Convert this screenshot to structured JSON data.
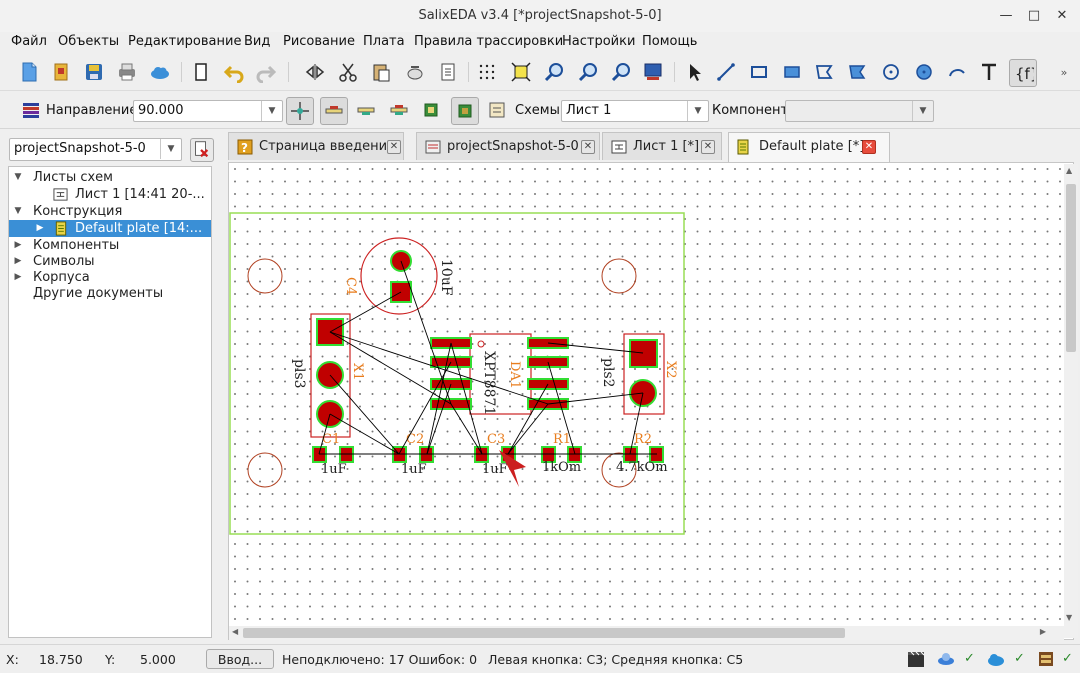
{
  "window": {
    "title": "SalixEDA v3.4 [*projectSnapshot-5-0]"
  },
  "menu": [
    "Файл",
    "Объекты",
    "Редактирование",
    "Вид",
    "Рисование",
    "Плата",
    "Правила трассировки",
    "Настройки",
    "Помощь"
  ],
  "toolbar2": {
    "direction_label": "Направление:",
    "direction_value": "90.000",
    "schemes_label": "Схемы:",
    "schemes_value": "Лист 1",
    "component_label": "Компонент:",
    "component_value": ""
  },
  "project_selector": {
    "value": "projectSnapshot-5-0"
  },
  "tree": {
    "items": [
      {
        "label": "Листы схем",
        "expanded": true
      },
      {
        "label": "Лист 1 [14:41 20-..."
      },
      {
        "label": "Конструкция",
        "expanded": true
      },
      {
        "label": "Default plate [14:...",
        "selected": true
      },
      {
        "label": "Компоненты",
        "expanded": false
      },
      {
        "label": "Символы",
        "expanded": false
      },
      {
        "label": "Корпуса",
        "expanded": false
      },
      {
        "label": "Другие документы"
      }
    ]
  },
  "tabs": [
    {
      "label": "Страница введения"
    },
    {
      "label": "projectSnapshot-5-0"
    },
    {
      "label": "Лист 1 [*]"
    },
    {
      "label": "Default plate [*]",
      "active": true
    }
  ],
  "pcb": {
    "labels": {
      "c4": "C4",
      "c4_value": "10uF",
      "x1": "X1",
      "x1_type": "pls3",
      "x2": "X2",
      "x2_type": "pls2",
      "da1": "DA1",
      "da1_type": "XPT8871",
      "c1": "C1",
      "c1_value": "1uF",
      "c2": "C2",
      "c2_value": "1uF",
      "c3": "C3",
      "c3_value": "1uF",
      "r1": "R1",
      "r1_value": "1kOm",
      "r2": "R2",
      "r2_value": "4.7kOm"
    },
    "colors": {
      "pad": "#c00000",
      "pad_outline": "#33dd33",
      "silk": "#cc2222",
      "designator": "#e87d1e",
      "board_edge": "#99dd55",
      "ratsnest": "#000000"
    }
  },
  "status": {
    "x_label": "X:",
    "x_value": "18.750",
    "y_label": "Y:",
    "y_value": "5.000",
    "input_button": "Ввод...",
    "summary": "Неподключено: 17 Ошибок: 0",
    "mouse_hint": "Левая кнопка: C3; Средняя кнопка: C5"
  }
}
